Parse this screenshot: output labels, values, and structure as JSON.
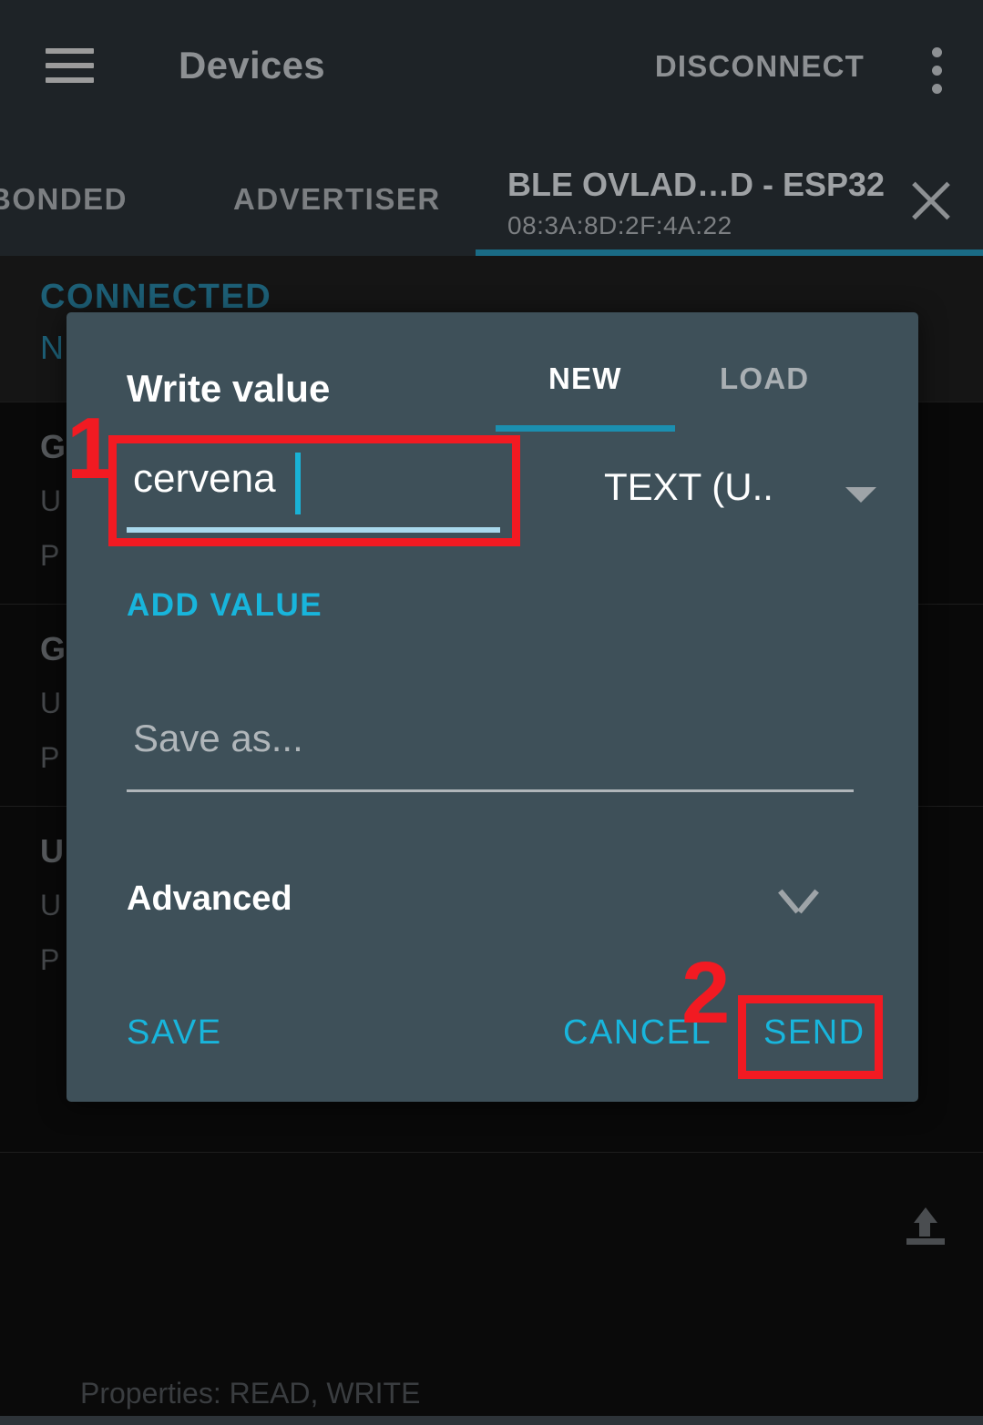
{
  "appbar": {
    "menu_icon": "hamburger-menu-icon",
    "title": "Devices",
    "disconnect_label": "DISCONNECT",
    "overflow_icon": "more-vertical-icon"
  },
  "tabs": {
    "bonded_label": "BONDED",
    "advertiser_label": "ADVERTISER",
    "device": {
      "name": "BLE OVLAD…D - ESP32",
      "mac": "08:3A:8D:2F:4A:22",
      "close_icon": "close-icon"
    }
  },
  "background": {
    "connected_header": "CONNECTED",
    "connected_sub": "N",
    "rows": [
      {
        "title": "G",
        "sub1": "U",
        "sub2": "P"
      },
      {
        "title": "G",
        "sub1": "U",
        "sub2": "P"
      },
      {
        "title": "U",
        "sub1": "U",
        "sub2": "P"
      }
    ],
    "properties_line": "Properties: READ, WRITE",
    "upload_icon": "upload-icon"
  },
  "dialog": {
    "title": "Write value",
    "tab_new": "NEW",
    "tab_load": "LOAD",
    "value": "cervena",
    "value_type": "TEXT (U..",
    "type_caret_icon": "chevron-down-icon",
    "add_value_label": "ADD VALUE",
    "save_as_placeholder": "Save as...",
    "advanced_label": "Advanced",
    "advanced_chevron_icon": "chevron-down-icon",
    "save_label": "SAVE",
    "cancel_label": "CANCEL",
    "send_label": "SEND"
  },
  "annotations": {
    "step_1": "1",
    "step_2": "2"
  },
  "colors": {
    "accent_cyan": "#18b5dc",
    "dialog_bg": "#3e5059",
    "appbar_bg": "#1e2327",
    "annotation_red": "#f21a22",
    "teal_header": "#1d5f76"
  }
}
